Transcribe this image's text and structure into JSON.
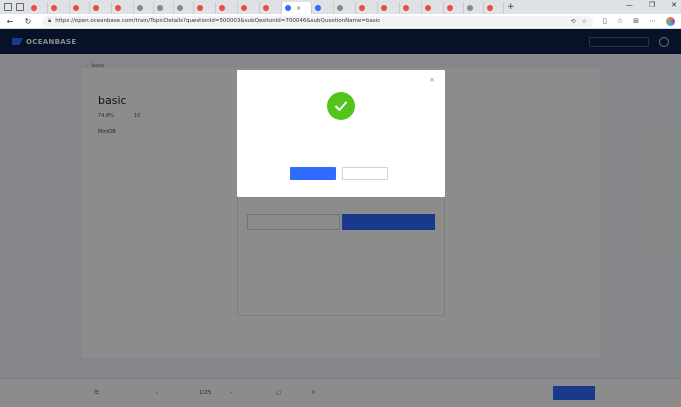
{
  "browser": {
    "tabs": [
      {
        "label": "",
        "color": "#e84c3d"
      },
      {
        "label": "",
        "color": "#e84c3d"
      },
      {
        "label": "",
        "color": "#e84c3d"
      },
      {
        "label": "",
        "color": "#e84c3d"
      },
      {
        "label": "",
        "color": "#e84c3d"
      },
      {
        "label": "",
        "color": "#888888"
      },
      {
        "label": "",
        "color": "#888888"
      },
      {
        "label": "",
        "color": "#888888"
      },
      {
        "label": "",
        "color": "#e84c3d"
      },
      {
        "label": "",
        "color": "#e84c3d"
      },
      {
        "label": "",
        "color": "#e84c3d"
      },
      {
        "label": "",
        "color": "#e84c3d"
      },
      {
        "label": "",
        "color": "#2f6bff",
        "active": true
      },
      {
        "label": "",
        "color": "#2f6bff"
      },
      {
        "label": "",
        "color": "#888888"
      },
      {
        "label": "",
        "color": "#e84c3d"
      },
      {
        "label": "",
        "color": "#e84c3d"
      },
      {
        "label": "",
        "color": "#e84c3d"
      },
      {
        "label": "",
        "color": "#e84c3d"
      },
      {
        "label": "",
        "color": "#e84c3d"
      },
      {
        "label": "",
        "color": "#888888"
      },
      {
        "label": "",
        "color": "#e84c3d"
      }
    ],
    "new_tab": "+",
    "url": "https://open.oceanbase.com/train/TopicDetails?questionId=500003&subQesitonId=700046&subQuestionName=basic",
    "window_controls": [
      "—",
      "❐",
      "✕"
    ]
  },
  "header": {
    "logo_text": "OCEANBASE",
    "nav": [
      "",
      "",
      "",
      "",
      "",
      "",
      ""
    ],
    "right_link": "",
    "search_placeholder": ""
  },
  "page": {
    "breadcrumb": [
      "",
      "basic"
    ],
    "question_title": "basic",
    "stats": [
      {
        "label": "",
        "value": "74.8%"
      },
      {
        "label": "",
        "value": ""
      },
      {
        "label": "",
        "value": "10"
      }
    ],
    "description": "MiniOB",
    "editor_hint": "",
    "reset_label": "",
    "submit_label": ""
  },
  "footer": {
    "list_label": "",
    "prev_label": "",
    "page_counter": "1/25",
    "next_label": "",
    "comment_label": "",
    "solution_label": "",
    "submit_all_label": ""
  },
  "modal": {
    "header_title": "",
    "close_glyph": "×",
    "title": "",
    "subtitle": "",
    "primary_button": "",
    "close_button": ""
  },
  "colors": {
    "accent": "#2f6bff",
    "success": "#52c41a",
    "header_bg": "#0d1f4a"
  }
}
